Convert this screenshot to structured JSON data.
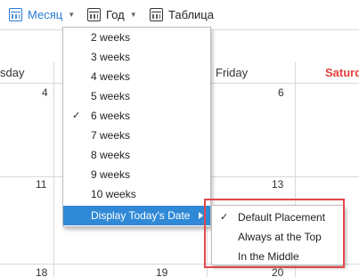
{
  "toolbar": {
    "month_label": "Месяц",
    "year_label": "Год",
    "table_label": "Таблица",
    "icons": {
      "month": "calendar-icon",
      "year": "calendar-icon",
      "table": "calendar-icon",
      "caret": "chevron-down-icon"
    }
  },
  "calendar": {
    "day_headers": {
      "wednesday": "sday",
      "friday": "Friday",
      "saturday": "Saturd"
    },
    "dates": {
      "r1_wed": "4",
      "r1_fri": "6",
      "r2_wed": "11",
      "r2_fri": "13",
      "r3_wed": "18",
      "r3_thu": "19",
      "r3_fri": "20"
    },
    "saturday_color": "#e0403a"
  },
  "menu": {
    "items": [
      {
        "label": "2 weeks",
        "checked": false
      },
      {
        "label": "3 weeks",
        "checked": false
      },
      {
        "label": "4 weeks",
        "checked": false
      },
      {
        "label": "5 weeks",
        "checked": false
      },
      {
        "label": "6 weeks",
        "checked": true
      },
      {
        "label": "7 weeks",
        "checked": false
      },
      {
        "label": "8 weeks",
        "checked": false
      },
      {
        "label": "9 weeks",
        "checked": false
      },
      {
        "label": "10 weeks",
        "checked": false
      }
    ],
    "check_glyph": "✓",
    "highlighted_item": "Display Today's Date",
    "highlight_color": "#2f89d6"
  },
  "submenu": {
    "items": [
      {
        "label": "Default Placement",
        "checked": true
      },
      {
        "label": "Always at the Top",
        "checked": false
      },
      {
        "label": "In the Middle",
        "checked": false
      }
    ],
    "check_glyph": "✓"
  },
  "accent_color": "#2a7bd4",
  "annotation_color": "#e0474c"
}
